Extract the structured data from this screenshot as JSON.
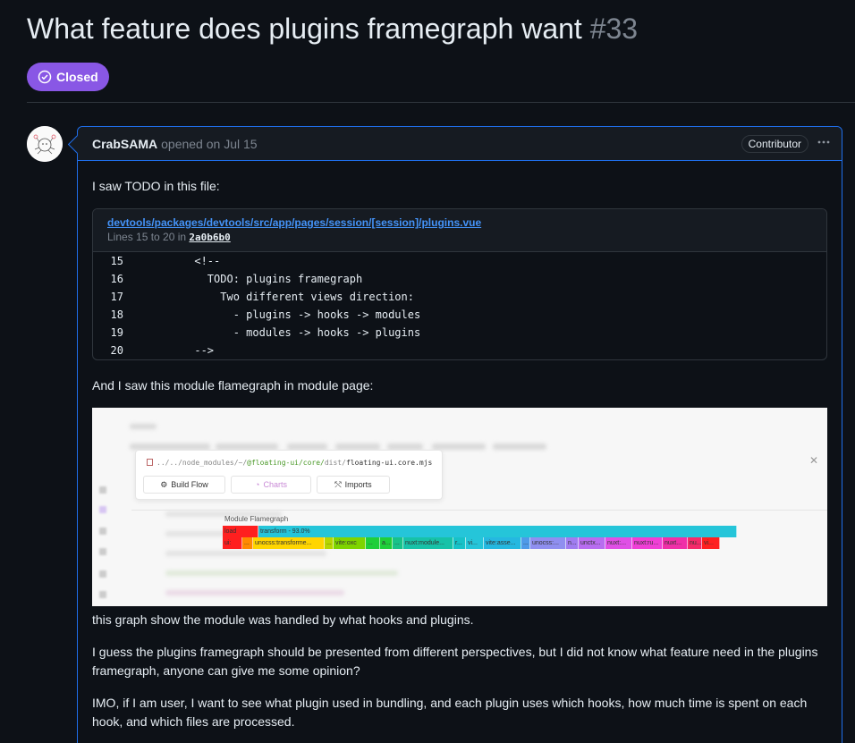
{
  "issue": {
    "title": "What feature does plugins framegraph want",
    "number": "#33",
    "state": "Closed",
    "state_color": "#8957e5"
  },
  "comment": {
    "author": "CrabSAMA",
    "meta": "opened on Jul 15",
    "badge": "Contributor",
    "more_icon": "kebab-horizontal-icon",
    "p1": "I saw TODO in this file:",
    "permalink": {
      "path": "devtools/packages/devtools/src/app/pages/session/[session]/plugins.vue",
      "lines_prefix": "Lines 15 to 20 in",
      "sha": "2a0b6b0",
      "code": [
        {
          "ln": "15",
          "src": "      <!--"
        },
        {
          "ln": "16",
          "src": "        TODO: plugins framegraph"
        },
        {
          "ln": "17",
          "src": "          Two different views direction:"
        },
        {
          "ln": "18",
          "src": "            - plugins -> hooks -> modules"
        },
        {
          "ln": "19",
          "src": "            - modules -> hooks -> plugins"
        },
        {
          "ln": "20",
          "src": "      -->"
        }
      ]
    },
    "p2": "And I saw this module flamegraph in module page:",
    "screenshot": {
      "file_path_prefix": "../../node_modules/~/",
      "file_path_hl": "@floating-ui/core/",
      "file_path_mid": "dist/",
      "file_path_file": "floating-ui.core.mjs",
      "tabs": [
        "Build Flow",
        "Charts",
        "Imports"
      ],
      "flamegraph_title": "Module Flamegraph",
      "row1": [
        {
          "label": "load",
          "color": "#ff1f1f"
        },
        {
          "label": "transform - 93.0%",
          "color": "#25c5d9"
        }
      ],
      "row2": [
        {
          "label": "ui:",
          "color": "#ff1f1f"
        },
        {
          "label": "...",
          "color": "#ff8a00"
        },
        {
          "label": "unocss:transforme...",
          "color": "#ffd500"
        },
        {
          "label": "...",
          "color": "#b7d600"
        },
        {
          "label": "vite:oxc",
          "color": "#7fd400"
        },
        {
          "label": "...",
          "color": "#1fcf3a"
        },
        {
          "label": "a...",
          "color": "#1fcf3a"
        },
        {
          "label": "...",
          "color": "#17c28a"
        },
        {
          "label": "nuxt:module...",
          "color": "#17c2a8"
        },
        {
          "label": "r...",
          "color": "#17c2c8"
        },
        {
          "label": "vi...",
          "color": "#25c5d9"
        },
        {
          "label": "vite:asse...",
          "color": "#25b8e0"
        },
        {
          "label": "...",
          "color": "#4f9ae8"
        },
        {
          "label": "unocss:...",
          "color": "#8f8ff0"
        },
        {
          "label": "n...",
          "color": "#a07cf0"
        },
        {
          "label": "unctx...",
          "color": "#b86cf0"
        },
        {
          "label": "nuxt:...",
          "color": "#e04fe6"
        },
        {
          "label": "nuxt:ru...",
          "color": "#f03fd6"
        },
        {
          "label": "nuxt...",
          "color": "#f02fa8"
        },
        {
          "label": "nu...",
          "color": "#f52a6a"
        },
        {
          "label": "vi...",
          "color": "#ff2020"
        }
      ]
    },
    "p3": "this graph show the module was handled by what hooks and plugins.",
    "p4": "I guess the plugins framegraph should be presented from different perspectives, but I did not know what feature need in the plugins framegraph, anyone can give me some opinion?",
    "p5": "IMO, if I am user, I want to see what plugin used in bundling, and each plugin uses which hooks, how much time is spent on each hook, and which files are processed."
  }
}
